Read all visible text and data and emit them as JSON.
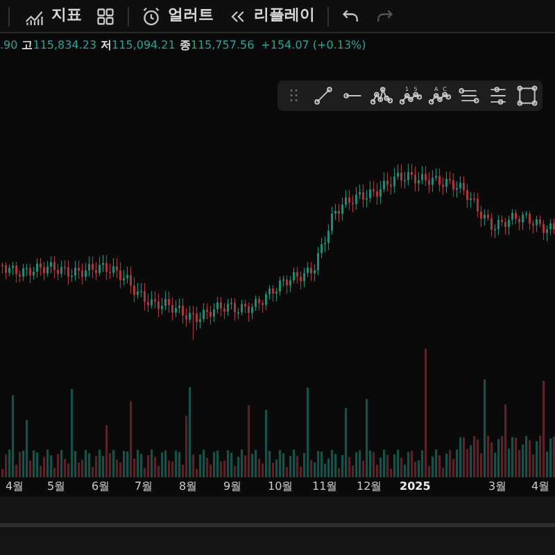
{
  "toolbar": {
    "items": [
      {
        "kind": "indicators",
        "label": "지표"
      },
      {
        "kind": "layout"
      },
      {
        "kind": "alert",
        "label": "얼러트"
      },
      {
        "kind": "replay",
        "label": "리플레이"
      },
      {
        "kind": "undo",
        "disabled": false
      },
      {
        "kind": "redo",
        "disabled": true
      }
    ]
  },
  "ohlc": {
    "open_tail": ".90",
    "high_label": "고",
    "high": "115,834.23",
    "low_label": "저",
    "low": "115,094.21",
    "close_label": "종",
    "close": "115,757.56",
    "change": "+154.07 (+0.13%)"
  },
  "drawing_tools": [
    {
      "kind": "handle"
    },
    {
      "kind": "trend"
    },
    {
      "kind": "ray"
    },
    {
      "kind": "pattern"
    },
    {
      "kind": "wave",
      "marks": [
        "1",
        "5"
      ]
    },
    {
      "kind": "wave",
      "marks": [
        "A",
        "C"
      ]
    },
    {
      "kind": "lines"
    },
    {
      "kind": "lines2"
    },
    {
      "kind": "rect"
    }
  ],
  "time_axis": [
    "4월",
    "5월",
    "6월",
    "7월",
    "8월",
    "9월",
    "10월",
    "11월",
    "12월",
    "2025",
    "3월",
    "4월"
  ]
}
